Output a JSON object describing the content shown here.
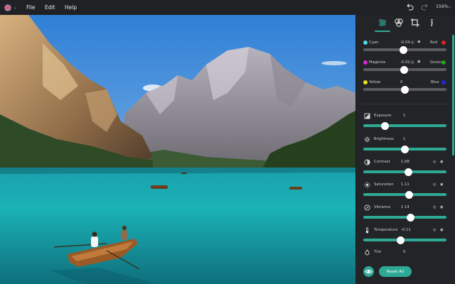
{
  "menubar": {
    "language_icon": "uk-flag-icon",
    "items": [
      "File",
      "Edit",
      "Help"
    ],
    "zoom": "156%"
  },
  "panel": {
    "tabs": [
      "adjustments-icon",
      "filters-icon",
      "crop-icon",
      "info-icon"
    ],
    "color_balance": [
      {
        "left": "Cyan",
        "value": "-0.04",
        "right": "Red",
        "left_color": "#4fd8e6",
        "right_color": "#e02020",
        "level": 0.48
      },
      {
        "left": "Magenta",
        "value": "-0.02",
        "right": "Green",
        "left_color": "#d12ad1",
        "right_color": "#21a321",
        "level": 0.49
      },
      {
        "left": "Yellow",
        "value": "0",
        "right": "Blue",
        "left_color": "#e7e318",
        "right_color": "#1d2bd8",
        "level": 0.5
      }
    ],
    "adjustments": [
      {
        "label": "Exposure",
        "value": "1",
        "icon": "exposure-icon",
        "level": 0.26
      },
      {
        "label": "Brightness",
        "value": "1",
        "icon": "brightness-icon",
        "level": 0.5
      },
      {
        "label": "Contrast",
        "value": "1.08",
        "icon": "contrast-icon",
        "level": 0.54
      },
      {
        "label": "Saturation",
        "value": "1.11",
        "icon": "saturation-icon",
        "level": 0.555
      },
      {
        "label": "Vibrance",
        "value": "1.14",
        "icon": "vibrance-icon",
        "level": 0.57
      },
      {
        "label": "Temperature",
        "value": "-0.11",
        "icon": "temperature-icon",
        "level": 0.445
      },
      {
        "label": "Tint",
        "value": "0",
        "icon": "tint-icon",
        "level": 0.5
      }
    ],
    "reset_label": "Reset All"
  },
  "colors": {
    "accent": "#2ea996",
    "panel_bg": "#232427",
    "menubar_bg": "#202124"
  }
}
